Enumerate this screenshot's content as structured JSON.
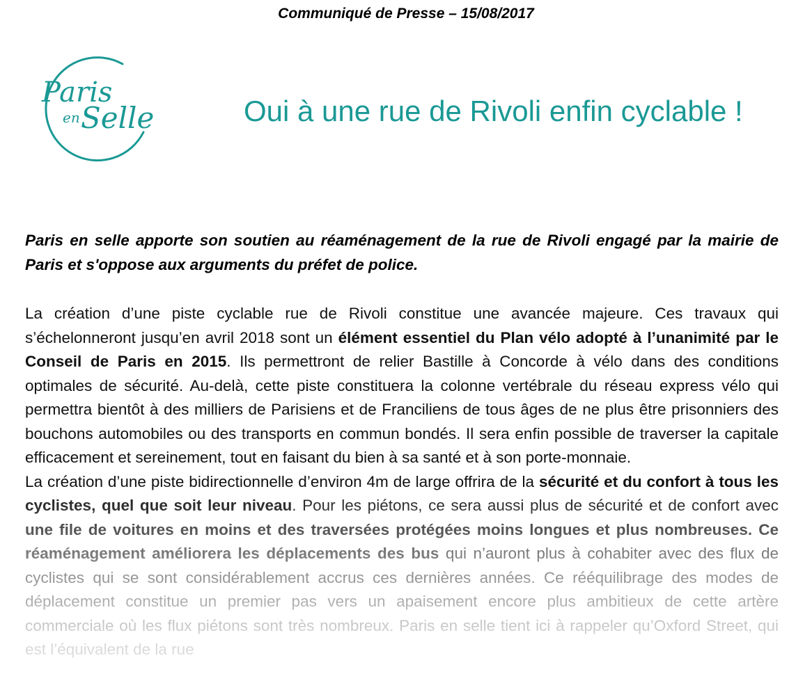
{
  "header": {
    "press_line": "Communiqué de Presse – 15/08/2017"
  },
  "logo": {
    "text_top": "Paris",
    "text_mid": "en",
    "text_bottom": "Selle",
    "color": "#1a9995"
  },
  "title": "Oui à une rue de Rivoli enfin cyclable !",
  "lead": "Paris en selle apporte son soutien au réaménagement de la rue de Rivoli engagé par la mairie de Paris et s'oppose aux arguments du préfet de police.",
  "paragraph1": {
    "s1": "La création d’une piste cyclable rue de Rivoli constitue une avancée majeure. Ces travaux qui s’échelonneront jusqu’en avril 2018 sont un ",
    "b1": "élément essentiel du Plan vélo adopté à l’unanimité par le Conseil de Paris en 2015",
    "s2": ". Ils permettront de relier Bastille à Concorde à vélo dans des conditions optimales de sécurité. Au-delà, cette piste constituera la colonne vertébrale du réseau express vélo qui permettra bientôt à des milliers de Parisiens et de Franciliens de tous âges de ne plus être prisonniers des bouchons automobiles ou des transports en commun bondés. Il sera enfin possible de traverser la capitale efficacement et sereinement, tout en faisant du bien à sa santé et à son porte-monnaie."
  },
  "paragraph2": {
    "s1": "La création d’une piste bidirectionnelle d’environ 4m de large offrira de la ",
    "b1": "sécurité et du confort à tous les cyclistes, quel que soit leur niveau",
    "s2": ". Pour les piétons, ce sera aussi plus de sécurité et de confort avec ",
    "b2": "une file de voitures en moins et des traversées protégées moins longues et plus nombreuses. Ce réaménagement améliorera les déplacements des bus",
    "s3": " qui n’auront plus à cohabiter avec des flux de cyclistes qui se sont considérablement accrus ces dernières années. Ce rééquilibrage des modes de déplacement constitue un premier pas vers un apaisement encore plus ambitieux de cette artère commerciale où les flux piétons sont très nombreux. Paris en selle tient ici à rappeler qu’Oxford Street, qui est l’équivalent de la rue"
  }
}
